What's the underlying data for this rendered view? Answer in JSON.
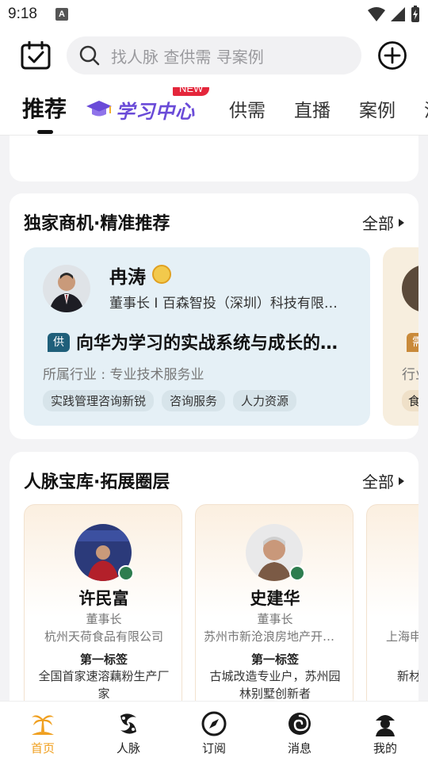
{
  "status": {
    "time": "9:18",
    "a_label": "A"
  },
  "search": {
    "placeholder": "找人脉 查供需 寻案例"
  },
  "tabs": [
    {
      "label": "推荐",
      "active": true
    },
    {
      "label": "学习中心",
      "badge": "NEW"
    },
    {
      "label": "供需"
    },
    {
      "label": "直播"
    },
    {
      "label": "案例"
    },
    {
      "label": "消"
    }
  ],
  "biz_section": {
    "title": "独家商机·精准推荐",
    "more": "全部",
    "card": {
      "name": "冉涛",
      "role": "董事长 I 百森智投（深圳）科技有限公司",
      "tag": "供",
      "headline": "向华为学习的实战系统与成长的路径",
      "industry": "所属行业 : 专业技术服务业",
      "chips": [
        "实践管理咨询新锐",
        "咨询服务",
        "人力资源"
      ]
    },
    "peek": {
      "tag": "需",
      "industry_prefix": "行业",
      "chip_prefix": "食"
    }
  },
  "people_section": {
    "title": "人脉宝库·拓展圈层",
    "more": "全部",
    "people": [
      {
        "name": "许民富",
        "title": "董事长",
        "company": "杭州天荷食品有限公司",
        "label": "第一标签",
        "desc": "全国首家速溶藕粉生产厂家"
      },
      {
        "name": "史建华",
        "title": "董事长",
        "company": "苏州市新沧浪房地产开发有限公司",
        "label": "第一标签",
        "desc": "古城改造专业户，苏州园林别墅创新者"
      }
    ],
    "peek": {
      "company": "上海申",
      "desc": "新材"
    }
  },
  "tabbar": [
    {
      "label": "首页",
      "icon": "island-icon",
      "active": true
    },
    {
      "label": "人脉",
      "icon": "people-swirl-icon"
    },
    {
      "label": "订阅",
      "icon": "compass-icon"
    },
    {
      "label": "消息",
      "icon": "spiral-icon"
    },
    {
      "label": "我的",
      "icon": "user-icon"
    }
  ],
  "colors": {
    "accent": "#f0a020",
    "learn": "#6a4bd8",
    "new_badge": "#e4263b",
    "supply_tag": "#1f5f7a"
  }
}
